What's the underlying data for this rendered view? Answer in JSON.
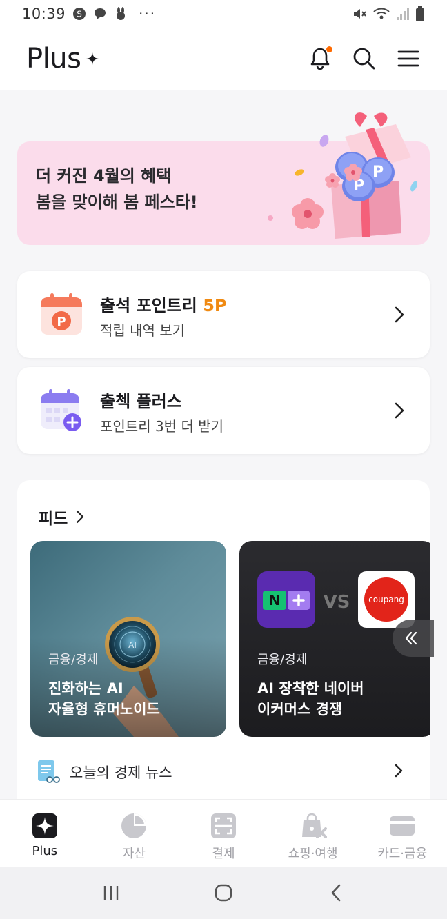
{
  "status_bar": {
    "time": "10:39",
    "more": "···"
  },
  "header": {
    "brand": "Plus"
  },
  "banner": {
    "line1": "더 커진 4월의 혜택",
    "line2": "봄을 맞이해 봄 페스타!"
  },
  "cards": [
    {
      "title": "출석 포인트리 ",
      "accent": "5P",
      "subtitle": "적립 내역 보기"
    },
    {
      "title": "출첵 플러스",
      "subtitle": "포인트리 3번 더 받기"
    }
  ],
  "feed": {
    "title": "피드",
    "items": [
      {
        "category": "금융/경제",
        "title_line1": "진화하는 AI",
        "title_line2": "자율형 휴머노이드",
        "image_text": "AI"
      },
      {
        "category": "금융/경제",
        "title_line1": "AI 장착한 네이버",
        "title_line2": "이커머스 경쟁",
        "vs_text": "VS",
        "logo_left": "N",
        "logo_right": "coupang"
      }
    ],
    "news_label": "오늘의 경제 뉴스"
  },
  "tabs": [
    {
      "label": "Plus",
      "active": true,
      "icon": "plus-sparkle-icon"
    },
    {
      "label": "자산",
      "active": false,
      "icon": "pie-chart-icon"
    },
    {
      "label": "결제",
      "active": false,
      "icon": "scan-icon"
    },
    {
      "label": "쇼핑·여행",
      "active": false,
      "icon": "shopping-bag-icon"
    },
    {
      "label": "카드·금융",
      "active": false,
      "icon": "card-icon"
    }
  ],
  "colors": {
    "accent": "#f08a12",
    "banner_bg": "#fbdceb",
    "notif": "#ff6a00"
  }
}
